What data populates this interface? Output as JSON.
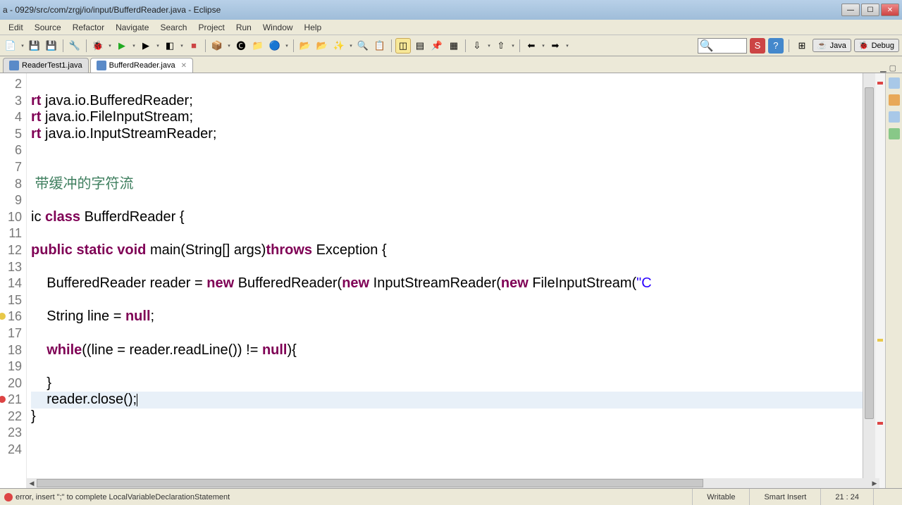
{
  "window": {
    "title": "a - 0929/src/com/zrgj/io/input/BufferdReader.java - Eclipse"
  },
  "menu": [
    "Edit",
    "Source",
    "Refactor",
    "Navigate",
    "Search",
    "Project",
    "Run",
    "Window",
    "Help"
  ],
  "tabs": [
    {
      "label": "ReaderTest1.java",
      "active": false
    },
    {
      "label": "BufferdReader.java",
      "active": true
    }
  ],
  "perspectives": {
    "java": "Java",
    "debug": "Debug"
  },
  "code": {
    "lines": [
      {
        "n": 2,
        "t": ""
      },
      {
        "n": 3,
        "t": "rt java.io.BufferedReader;",
        "prefix_kw": true
      },
      {
        "n": 4,
        "t": "rt java.io.FileInputStream;",
        "prefix_kw": true
      },
      {
        "n": 5,
        "t": "rt java.io.InputStreamReader;",
        "prefix_kw": true
      },
      {
        "n": 6,
        "t": ""
      },
      {
        "n": 7,
        "t": ""
      },
      {
        "n": 8,
        "t": " 带缓冲的字符流",
        "comment": true
      },
      {
        "n": 9,
        "t": ""
      },
      {
        "n": 10,
        "t": "ic class BufferdReader {",
        "tokens": [
          "ic ",
          {
            "k": "class"
          },
          " BufferdReader {"
        ]
      },
      {
        "n": 11,
        "t": ""
      },
      {
        "n": 12,
        "t": "public static void main(String[] args)throws Exception {",
        "tokens": [
          {
            "k": "public"
          },
          " ",
          {
            "k": "static"
          },
          " ",
          {
            "k": "void"
          },
          " main(String[] args)",
          {
            "k": "throws"
          },
          " Exception {"
        ]
      },
      {
        "n": 13,
        "t": ""
      },
      {
        "n": 14,
        "t": "    BufferedReader reader = new BufferedReader(new InputStreamReader(new FileInputStream(\"C",
        "tokens": [
          "    BufferedReader reader = ",
          {
            "k": "new"
          },
          " BufferedReader(",
          {
            "k": "new"
          },
          " InputStreamReader(",
          {
            "k": "new"
          },
          " FileInputStream(",
          {
            "s": "\"C"
          }
        ]
      },
      {
        "n": 15,
        "t": ""
      },
      {
        "n": 16,
        "t": "    String line = null;",
        "tokens": [
          "    String line = ",
          {
            "k": "null"
          },
          ";"
        ],
        "warn": true
      },
      {
        "n": 17,
        "t": ""
      },
      {
        "n": 18,
        "t": "    while((line = reader.readLine()) != null){",
        "tokens": [
          "    ",
          {
            "k": "while"
          },
          "((line = reader.readLine()) != ",
          {
            "k": "null"
          },
          "){"
        ]
      },
      {
        "n": 19,
        "t": ""
      },
      {
        "n": 20,
        "t": "    }"
      },
      {
        "n": 21,
        "t": "    reader.close();",
        "hl": true,
        "cursor": true,
        "err": true
      },
      {
        "n": 22,
        "t": "}"
      },
      {
        "n": 23,
        "t": ""
      },
      {
        "n": 24,
        "t": ""
      }
    ]
  },
  "status": {
    "error_msg": "error, insert \";\" to complete LocalVariableDeclarationStatement",
    "writable": "Writable",
    "insert_mode": "Smart Insert",
    "position": "21 : 24"
  }
}
